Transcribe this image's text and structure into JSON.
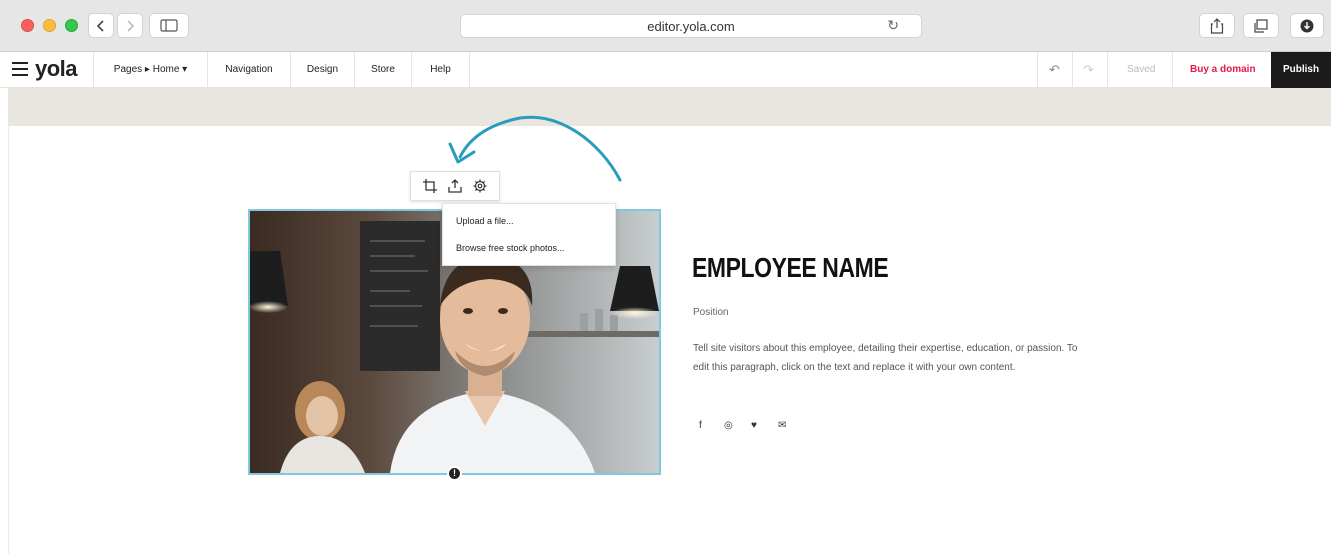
{
  "browser": {
    "url": "editor.yola.com"
  },
  "app": {
    "logo": "yola",
    "nav": {
      "pages_label": "Pages ▸ Home ▾",
      "navigation_label": "Navigation",
      "design_label": "Design",
      "store_label": "Store",
      "help_label": "Help"
    },
    "status": "Saved",
    "buy_domain_label": "Buy a domain",
    "publish_label": "Publish"
  },
  "image_toolbar": {
    "icons": [
      "crop-icon",
      "upload-icon",
      "gear-icon"
    ]
  },
  "upload_menu": {
    "items": [
      "Upload a file...",
      "Browse free stock photos..."
    ]
  },
  "employee": {
    "name": "EMPLOYEE NAME",
    "position": "Position",
    "description": "Tell site visitors about this employee, detailing their expertise, education, or passion. To edit this paragraph, click on the text and replace it with your own content.",
    "social": [
      "f",
      "◎",
      "♥",
      "✉"
    ]
  },
  "colors": {
    "accent": "#2a9cbd",
    "selection": "#7fc8de",
    "brand_pink": "#e8174a",
    "publish_bg": "#1a1a1a",
    "band": "#e9e6e0"
  }
}
